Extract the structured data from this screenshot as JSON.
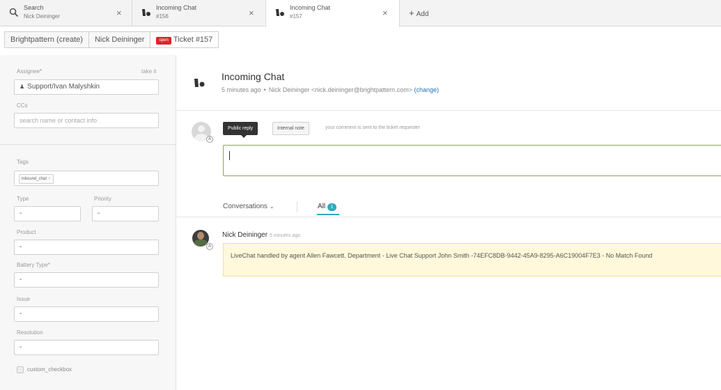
{
  "top_tabs": [
    {
      "title": "Search",
      "subtitle": "Nick Deininger",
      "icon": "search-icon"
    },
    {
      "title": "Incoming Chat",
      "subtitle": "#156",
      "icon": "chat-icon"
    },
    {
      "title": "Incoming Chat",
      "subtitle": "#157",
      "icon": "chat-icon"
    }
  ],
  "close_glyph": "×",
  "add_tab_label": "Add",
  "sub_tabs": {
    "org": "Brightpattern (create)",
    "user": "Nick Deininger",
    "status": "open",
    "ticket": "Ticket #157"
  },
  "sidebar": {
    "assignee_label": "Assignee*",
    "take_it": "take it",
    "assignee_value": "Support/Ivan Malyshkin",
    "ccs_label": "CCs",
    "ccs_placeholder": "search name or contact info",
    "tags_label": "Tags",
    "tag": "inbound_chat",
    "type_label": "Type",
    "type_value": "-",
    "priority_label": "Priority",
    "priority_value": "-",
    "product_label": "Product",
    "product_value": "-",
    "battery_label": "Battery Type*",
    "battery_value": "-",
    "issue_label": "Issue",
    "issue_value": "-",
    "resolution_label": "Resolution",
    "resolution_value": "-",
    "checkbox_label": "custom_checkbox"
  },
  "ticket": {
    "title": "Incoming Chat",
    "time": "5 minutes ago",
    "requester": "Nick Deininger <nick.deininger@brightpattern.com>",
    "change": "(change)"
  },
  "composer": {
    "public_reply": "Public reply",
    "internal_note": "Internal note",
    "hint": "your comment is sent to the ticket requester"
  },
  "conversation_tabs": {
    "conversations": "Conversations",
    "all": "All",
    "count": "1"
  },
  "comment": {
    "author": "Nick Deininger",
    "time": "5 minutes ago",
    "body": "LiveChat handled by agent Allen Fawcett. Department - Live Chat Support John Smith -74EFC8DB-9442-45A9-8295-A6C19004F7E3 - No Match Found"
  },
  "colors": {
    "accent": "#30aabc",
    "status_open": "#d9262c",
    "link": "#1f73b7",
    "message_bg": "#fff8da"
  }
}
